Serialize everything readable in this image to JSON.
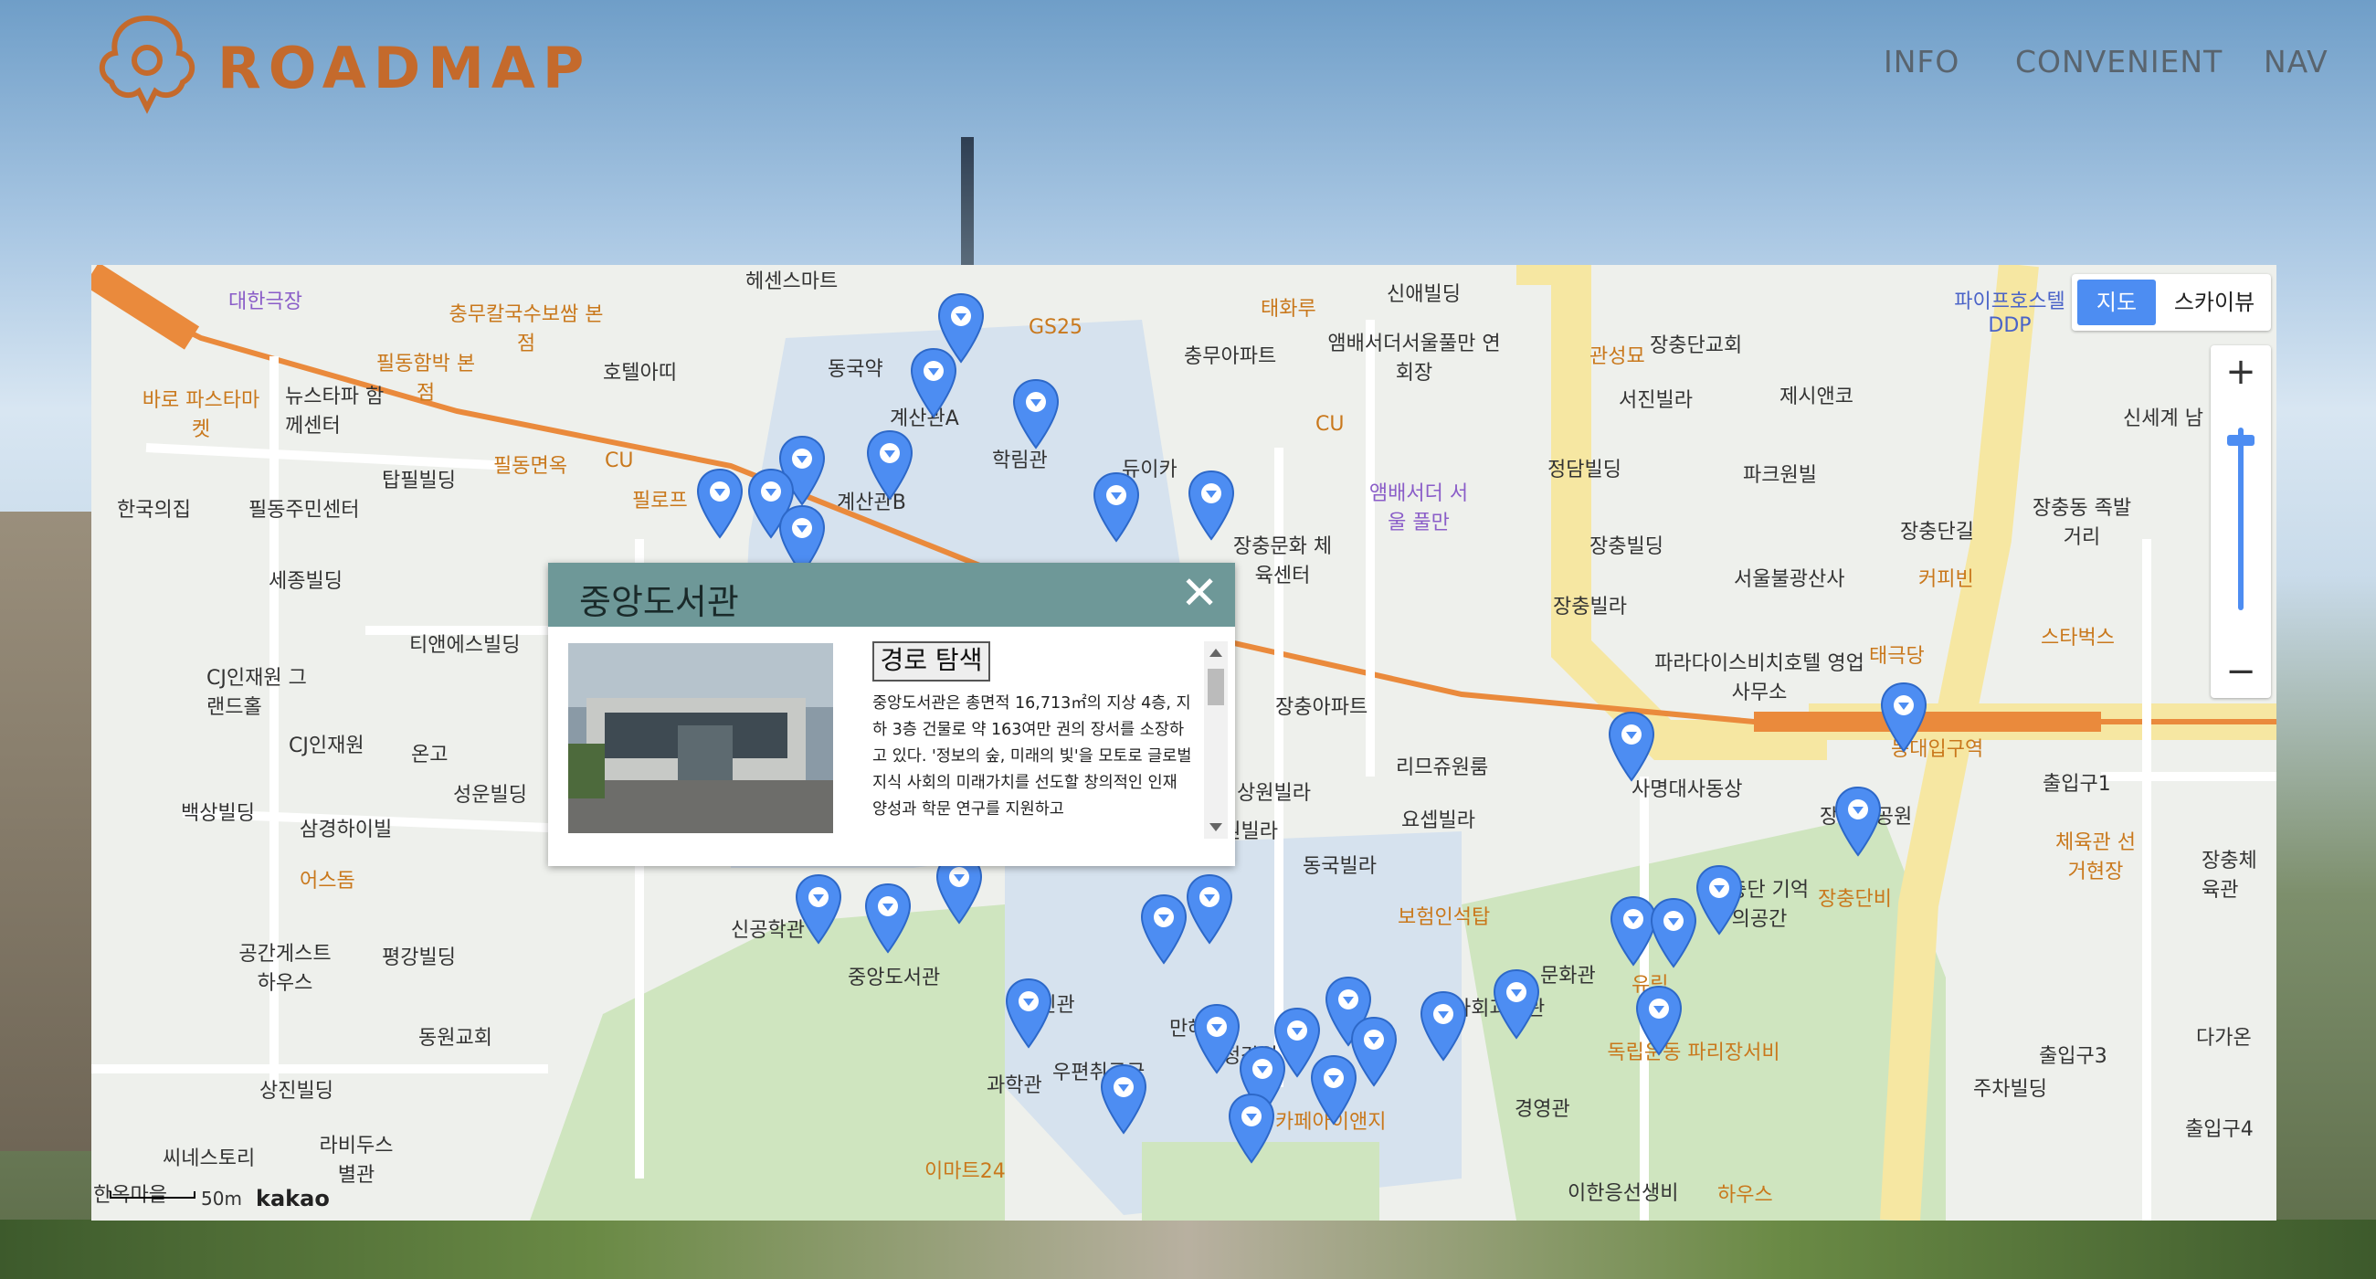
{
  "header": {
    "logo_text": "ROADMAP",
    "nav": [
      "INFO",
      "CONVENIENT",
      "NAV"
    ]
  },
  "map": {
    "map_type": {
      "map": "지도",
      "skyview": "스카이뷰"
    },
    "zoom": {
      "in": "+",
      "out": "−"
    },
    "scale_label": "50m",
    "attribution": "kakao",
    "labels": [
      "대한극장",
      "바로 파스타마켓",
      "필동함박 본점",
      "충무칼국수보쌈 본점",
      "호텔아띠",
      "뉴스타파 함께센터",
      "탑필빌딩",
      "필동면옥",
      "CU",
      "필로프",
      "한국의집",
      "필동주민센터",
      "세종빌딩",
      "티앤에스빌딩",
      "CJ인재원 그랜드홀",
      "CJ인재원",
      "온고",
      "성운빌딩",
      "삼경하이빌",
      "백상빌딩",
      "어스돔",
      "공간게스트 하우스",
      "평강빌딩",
      "동원교회",
      "상진빌딩",
      "씨네스토리",
      "라비두스 별관",
      "헤센스마트",
      "동국약",
      "계산관A",
      "계산관B",
      "학림관",
      "GS25",
      "태화루",
      "충무아파트",
      "CU",
      "신애빌딩",
      "앰배서더서울풀만 연회장",
      "앰배서더 서울 풀만",
      "관성묘",
      "장충단교회",
      "서진빌라",
      "제시앤코",
      "파이프호스텔 DDP",
      "정담빌딩",
      "파크원빌",
      "장충단길",
      "장충동 족발거리",
      "장충문화 체육센터",
      "장충빌딩",
      "서울불광산사",
      "커피빈",
      "장충빌라",
      "파라다이스비치호텔 영업사무소",
      "태극당",
      "스타벅스",
      "장충아파트",
      "리므쥬원룸",
      "상원빌라",
      "우원빌라",
      "요셉빌라",
      "동국빌라",
      "사명대사동상",
      "장충단공원",
      "동대입구역",
      "출입구1",
      "체육관 선거현장",
      "장충체육관",
      "장충단비",
      "보험인석탑",
      "장충단 기억의공간",
      "문화관",
      "유림",
      "독립운동 파리장서비",
      "신공학관",
      "중앙도서관",
      "명진관",
      "우편취급국",
      "과학관",
      "이마트24",
      "만해관",
      "정각원",
      "카페아이앤지",
      "사회과학관",
      "경영관",
      "이한응선생비",
      "하우스",
      "다가온",
      "주차빌딩",
      "출입구3",
      "출입구4",
      "신세계 남",
      "한옥마을",
      "듀이카"
    ]
  },
  "popup": {
    "title": "중앙도서관",
    "close": "✕",
    "route_button": "경로 탐색",
    "description": "중앙도서관은 총면적 16,713㎡의 지상 4층, 지하 3층 건물로 약 163여만 권의 장서를 소장하고 있다. '정보의 숲, 미래의 빛'을 모토로 글로벌 지식 사회의 미래가치를 선도할 창의적인 인재 양성과 학문 연구를 지원하고"
  },
  "colors": {
    "accent": "#4d8df2",
    "logo": "#c46a2c",
    "popup_header": "#6e9898",
    "route_line": "#ea8a3c"
  }
}
